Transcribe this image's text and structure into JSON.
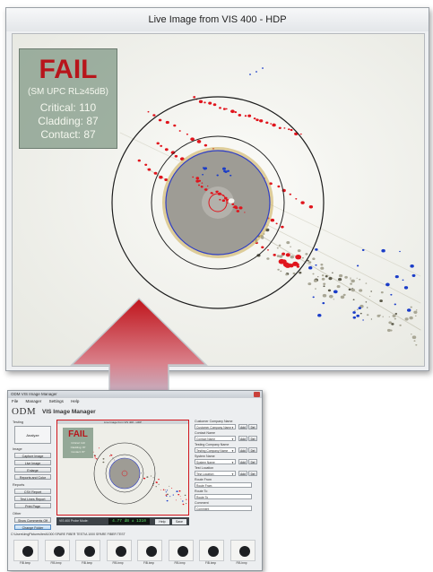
{
  "live_window": {
    "title": "Live Image from VIS 400 - HDP",
    "result": {
      "status": "FAIL",
      "spec": "(SM UPC RL≥45dB)",
      "critical": "Critical: 110",
      "cladding": "Cladding: 87",
      "contact": "Contact: 87"
    },
    "colors": {
      "fail": "#b8151b",
      "defect_red": "#e0141c",
      "defect_blue": "#1a3cc8"
    }
  },
  "arrow": {
    "colors": {
      "top": "#c0141b",
      "bottom": "#b9d3ea"
    }
  },
  "app": {
    "window_title": "ODM VIS Image Manager",
    "menu": [
      "File",
      "Manager",
      "Settings",
      "Help"
    ],
    "logo": "ODM",
    "heading": "VIS Image Manager",
    "sidebar": {
      "testing_label": "Testing",
      "analyze": "Analyze",
      "image_label": "Image",
      "image_buttons": [
        "Capture Image",
        "Live Image",
        "Enlarge",
        "Reports and Color"
      ],
      "reports_label": "Reports",
      "report_buttons": [
        "CSV Report",
        "Test Lines Report",
        "Print Page"
      ],
      "other_label": "Other",
      "other_buttons": [
        "Show Comments Off",
        "Change Folder"
      ]
    },
    "thumb_title": "Live Image from VIS 400 - HDP",
    "mini_result": {
      "status": "FAIL",
      "critical": "Critical: 110",
      "cladding": "Cladding: 87",
      "contact": "Contact: 87"
    },
    "status": {
      "label": "VIS 400 Probe Mode:",
      "value": "4.77 dB ± 1310",
      "help": "Help",
      "save": "Save"
    },
    "right_panel": {
      "customer_label": "Customer Company Name",
      "customer_value": "Customer Company Name",
      "contact_label": "Contact Name",
      "contact_value": "Contact Name",
      "testing_label": "Testing Company Name",
      "testing_value": "Testing Company Name",
      "system_label": "System Name",
      "system_value": "System Name",
      "location_label": "Test Location",
      "location_value": "Test Location",
      "from_label": "Route From",
      "from_value": "Route From",
      "to_label": "Route To",
      "to_value": "Route To",
      "comment_label": "Comment",
      "comment_value": "Comment",
      "add": "Add",
      "del": "Del"
    },
    "path": "C:\\Users\\ImgPictures\\test\\1000 SPARE FIBER TEST\\A 1000 SPARE FIBER TEST",
    "thumbnails": [
      "FIB.bmp",
      "FIB.bmp",
      "FIB.bmp",
      "FIB.bmp",
      "FIB.bmp",
      "FIB.bmp",
      "FIB.bmp",
      "FIB.bmp"
    ]
  }
}
